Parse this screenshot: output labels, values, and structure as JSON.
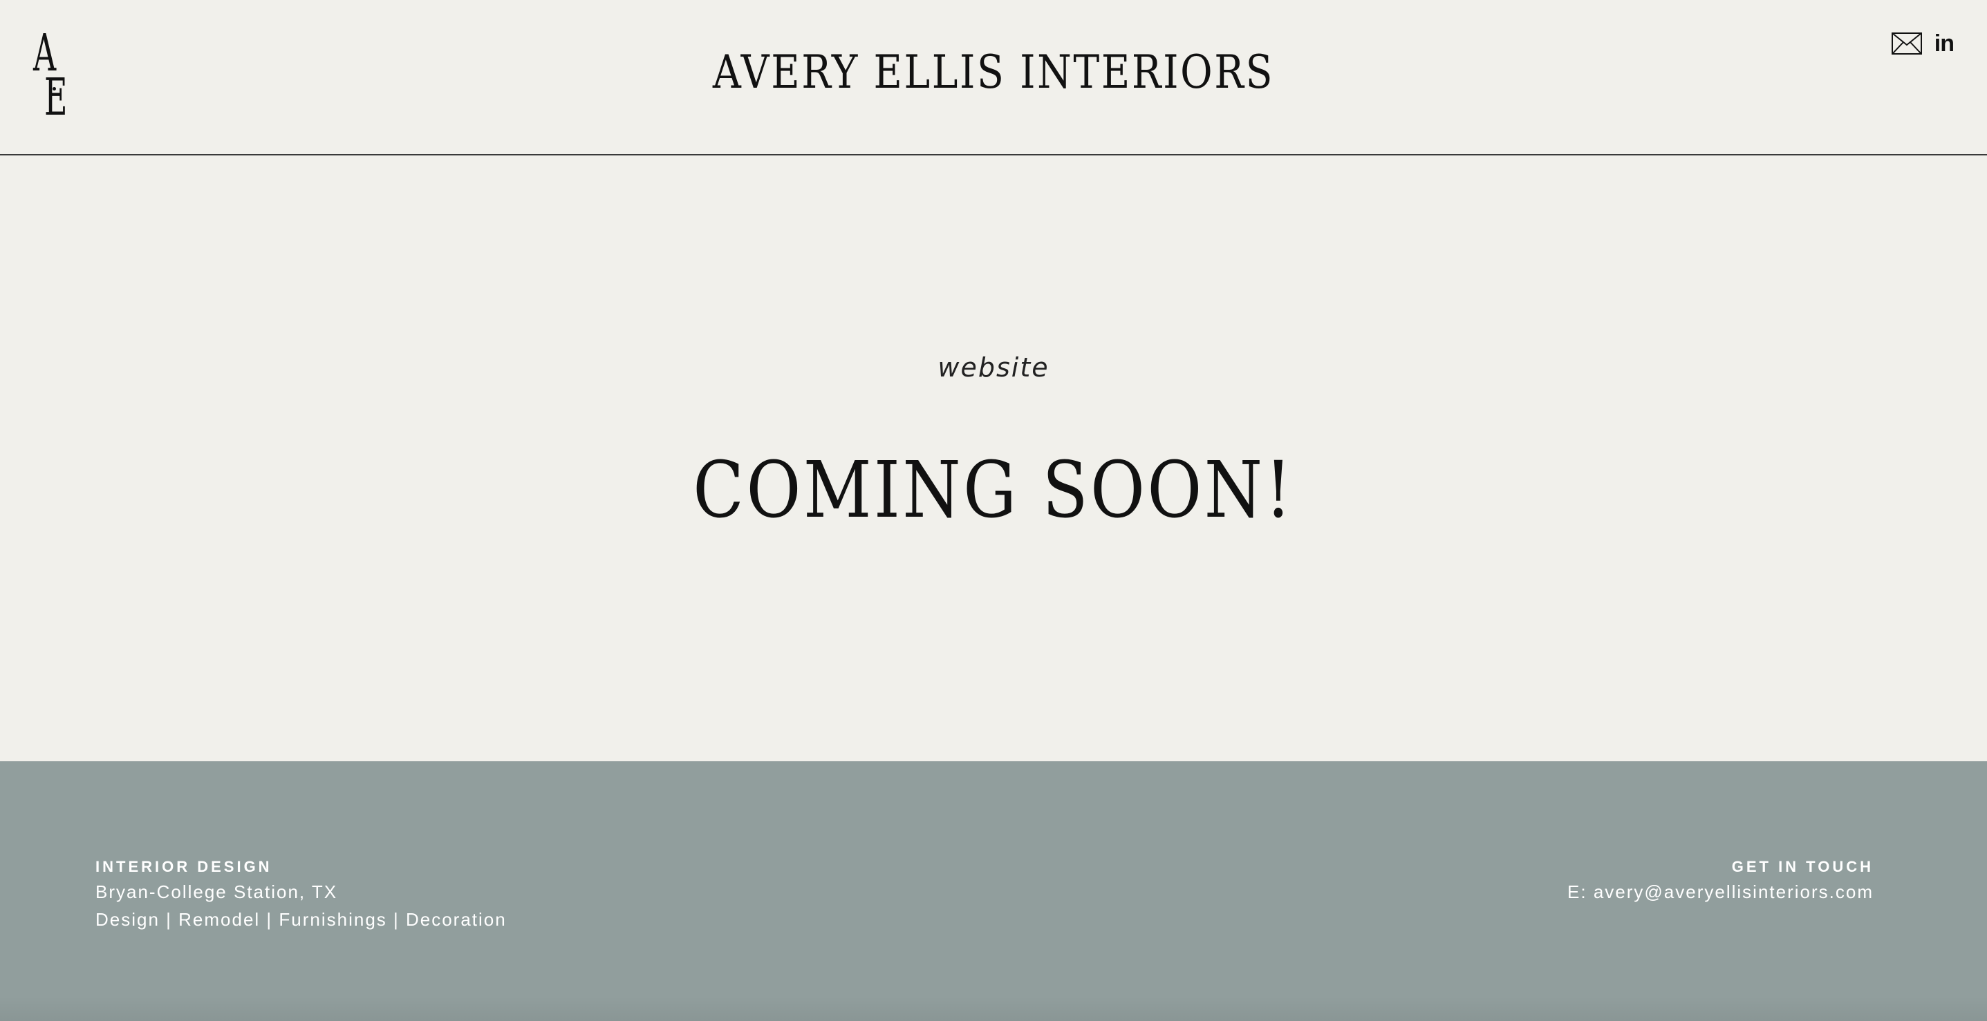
{
  "header": {
    "logo": {
      "letter_top": "A",
      "letter_bottom": "E"
    },
    "brand_title": "AVERY ELLIS INTERIORS",
    "social": [
      {
        "icon": "mail-icon"
      },
      {
        "icon": "linkedin-icon",
        "glyph": "in"
      }
    ]
  },
  "main": {
    "kicker": "website",
    "headline": "COMING SOON!"
  },
  "footer": {
    "left": {
      "heading": "INTERIOR DESIGN",
      "location": "Bryan-College Station, TX",
      "services": "Design | Remodel | Furnishings | Decoration"
    },
    "right": {
      "heading": "GET IN TOUCH",
      "email": "E: avery@averyellisinteriors.com"
    }
  },
  "colors": {
    "page_background": "#f1f0eb",
    "footer_background": "#919e9d",
    "text_dark": "#111111",
    "text_light": "#ffffff"
  }
}
